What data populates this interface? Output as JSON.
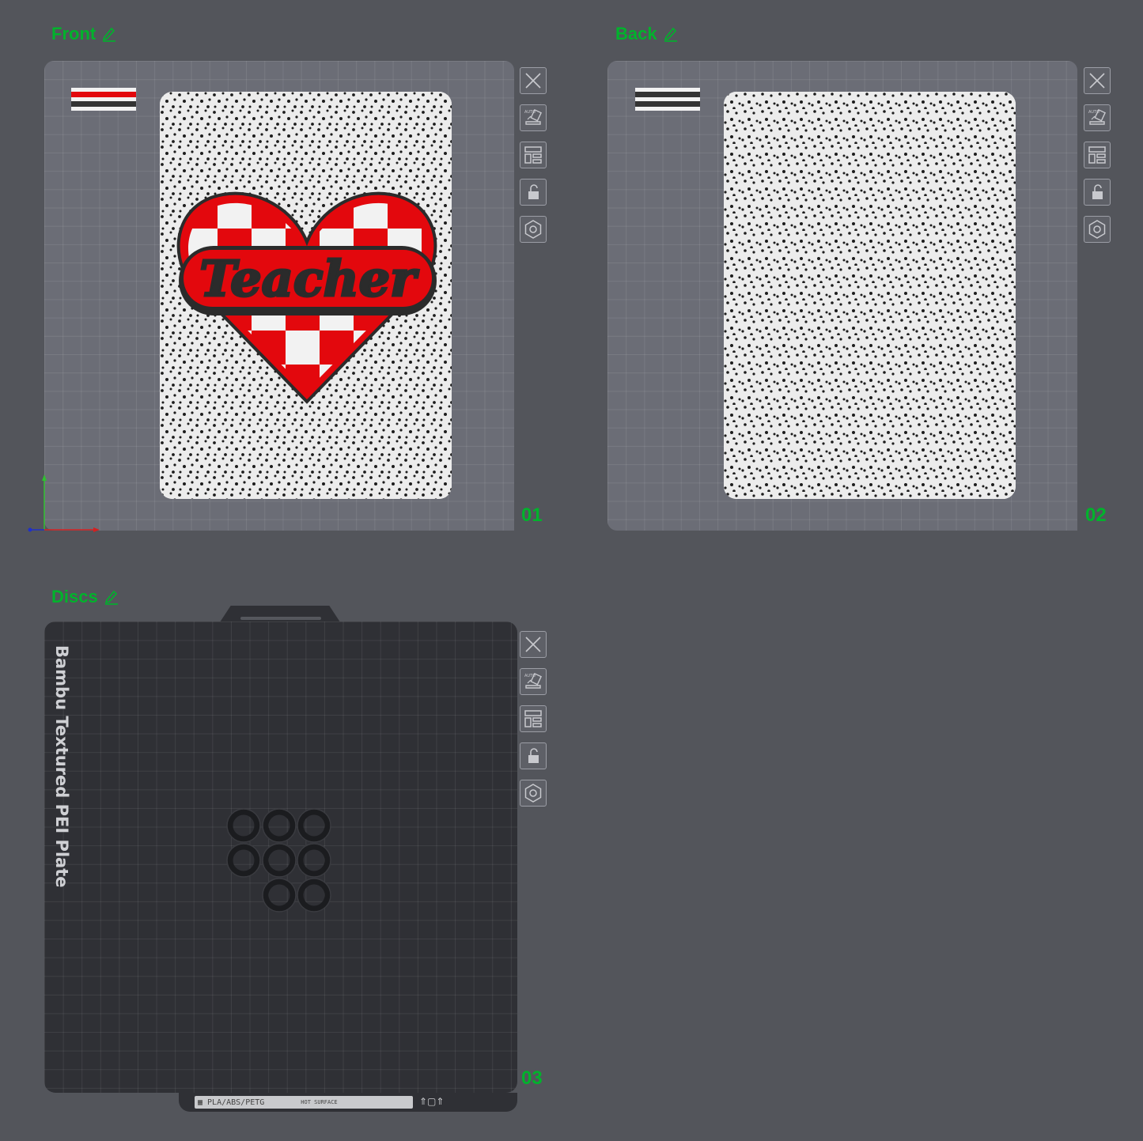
{
  "plates": [
    {
      "title": "Front",
      "number": "01"
    },
    {
      "title": "Back",
      "number": "02"
    },
    {
      "title": "Discs",
      "number": "03"
    }
  ],
  "front_card": {
    "heart_text": "Teacher"
  },
  "bed_label": "Bambu Textured PEI Plate",
  "footer": {
    "filaments": "PLA/ABS/PETG",
    "warning": "HOT SURFACE"
  },
  "toolbar_icons": [
    "close-icon",
    "auto-orient-icon",
    "arrange-icon",
    "lock-icon",
    "plate-settings-icon"
  ],
  "colors": {
    "accent": "#00b32c",
    "red": "#e3080d",
    "dark": "#2f3035",
    "bed": "#6b6d76",
    "background": "#53555b"
  }
}
